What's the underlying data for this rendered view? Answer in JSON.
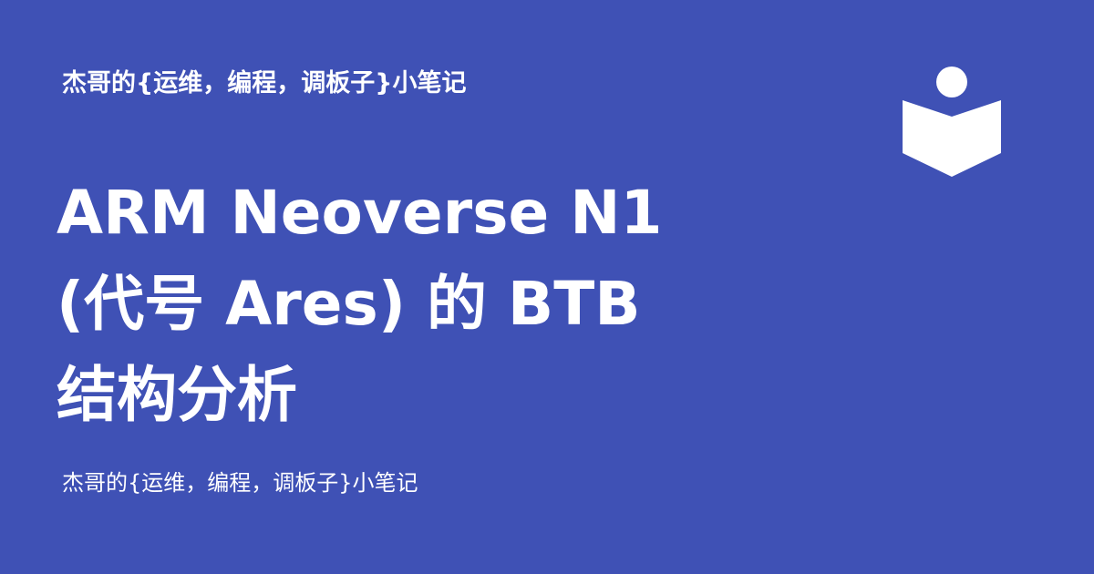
{
  "header": {
    "site_name": "杰哥的{运维，编程，调板子}小笔记"
  },
  "main": {
    "title_line1": "ARM Neoverse N1",
    "title_line2": "(代号 Ares) 的 BTB",
    "title_line3": "结构分析"
  },
  "footer": {
    "site_name": "杰哥的{运维，编程，调板子}小笔记"
  },
  "logo": {
    "icon": "reader-book-icon",
    "color": "#ffffff"
  },
  "colors": {
    "background": "#3f51b5",
    "text": "#ffffff"
  }
}
